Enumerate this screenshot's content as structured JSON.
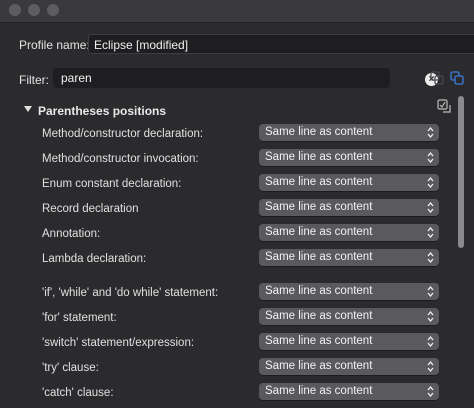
{
  "window": {
    "buttons": [
      "close",
      "minimize",
      "zoom"
    ]
  },
  "profile": {
    "label": "Profile name:",
    "value": "Eclipse [modified]"
  },
  "filter": {
    "label": "Filter:",
    "value": "paren"
  },
  "section": {
    "title": "Parentheses positions",
    "expanded": true
  },
  "options": [
    {
      "label": "Method/constructor declaration:",
      "value": "Same line as content"
    },
    {
      "label": "Method/constructor invocation:",
      "value": "Same line as content"
    },
    {
      "label": "Enum constant declaration:",
      "value": "Same line as content"
    },
    {
      "label": "Record declaration",
      "value": "Same line as content"
    },
    {
      "label": "Annotation:",
      "value": "Same line as content"
    },
    {
      "label": "Lambda declaration:",
      "value": "Same line as content"
    },
    {
      "label": "'if', 'while' and 'do while' statement:",
      "value": "Same line as content"
    },
    {
      "label": "'for' statement:",
      "value": "Same line as content"
    },
    {
      "label": "'switch' statement/expression:",
      "value": "Same line as content"
    },
    {
      "label": "'try' clause:",
      "value": "Same line as content"
    },
    {
      "label": "'catch' clause:",
      "value": "Same line as content"
    }
  ],
  "colors": {
    "background": "#2b2b2e",
    "select": "#5a595d",
    "field": "#1e1e20",
    "accent_icon": "#3d7de0"
  }
}
